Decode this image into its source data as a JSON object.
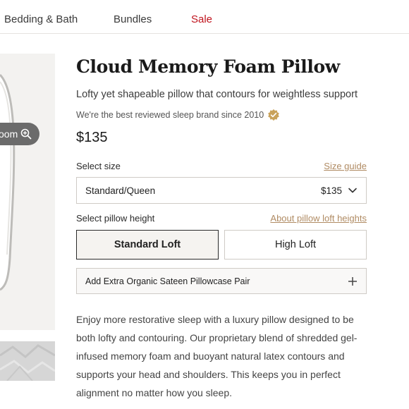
{
  "nav": {
    "items": [
      "Bedding & Bath",
      "Bundles",
      "Sale"
    ]
  },
  "gallery": {
    "zoom_label": "oom",
    "zoom_icon": "zoom-in-icon"
  },
  "product": {
    "title": "Cloud Memory Foam Pillow",
    "subtitle": "Lofty yet shapeable pillow that contours for weightless support",
    "tagline": "We're the best reviewed sleep brand since 2010",
    "tagline_icon": "verified-badge-icon",
    "price": "$135",
    "size": {
      "label": "Select size",
      "guide_link": "Size guide",
      "selected": "Standard/Queen",
      "selected_price": "$135"
    },
    "height": {
      "label": "Select pillow height",
      "about_link": "About pillow loft heights",
      "options": [
        "Standard Loft",
        "High Loft"
      ],
      "selected": "Standard Loft"
    },
    "addon": {
      "label": "Add Extra Organic Sateen Pillowcase Pair"
    },
    "description": "Enjoy more restorative sleep with a luxury pillow designed to be both lofty and contouring. Our proprietary blend of shredded gel-infused memory foam and buoyant natural latex contours and supports your head and shoulders. This keeps you in perfect alignment no matter how you sleep."
  },
  "colors": {
    "sale": "#c0141e",
    "link": "#b08b63",
    "badge": "#c9a25a"
  }
}
